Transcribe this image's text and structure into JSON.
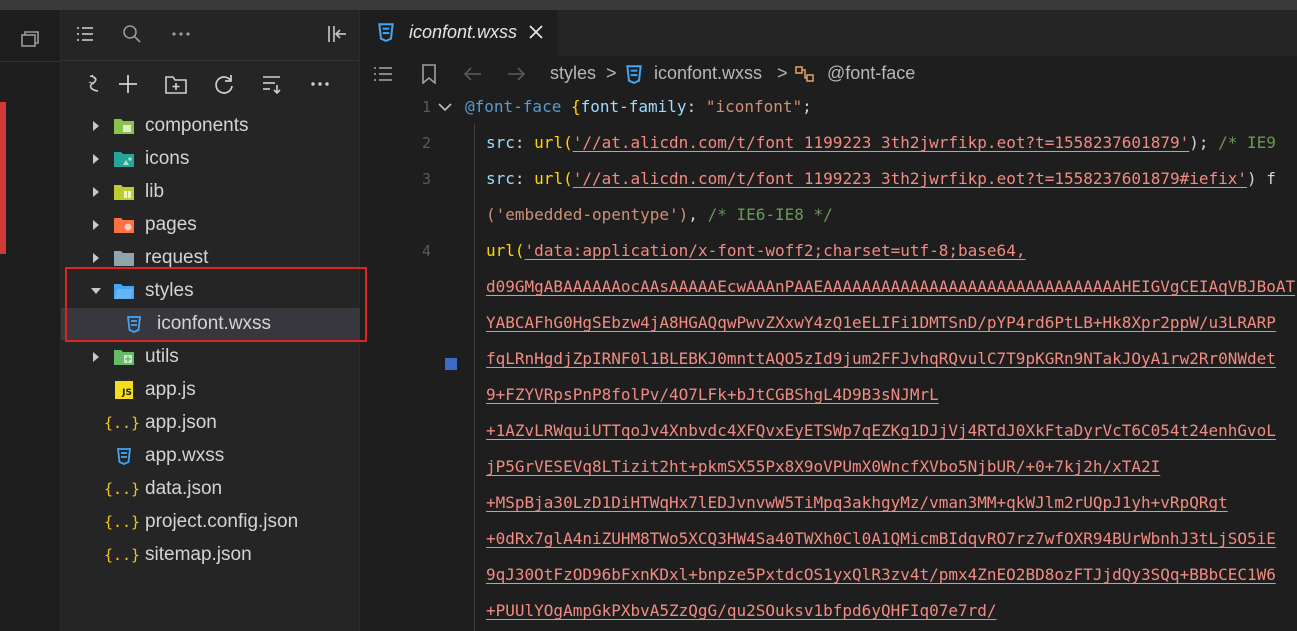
{
  "explorer": {
    "tree": [
      {
        "label": "components",
        "kind": "folder",
        "expanded": false,
        "color": "#8bc34a",
        "icon": "components-folder-icon"
      },
      {
        "label": "icons",
        "kind": "folder",
        "expanded": false,
        "color": "#26a69a",
        "icon": "images-folder-icon"
      },
      {
        "label": "lib",
        "kind": "folder",
        "expanded": false,
        "color": "#c0ca33",
        "icon": "lib-folder-icon"
      },
      {
        "label": "pages",
        "kind": "folder",
        "expanded": false,
        "color": "#ff7043",
        "icon": "pages-folder-icon"
      },
      {
        "label": "request",
        "kind": "folder",
        "expanded": false,
        "color": "#90a4ae",
        "icon": "folder-icon"
      },
      {
        "label": "styles",
        "kind": "folder",
        "expanded": true,
        "color": "#42a5f5",
        "icon": "styles-folder-icon"
      },
      {
        "label": "iconfont.wxss",
        "kind": "file",
        "selected": true,
        "color": "#42a5f5",
        "icon": "css-file-icon"
      },
      {
        "label": "utils",
        "kind": "folder",
        "expanded": false,
        "color": "#66bb6a",
        "icon": "utils-folder-icon"
      },
      {
        "label": "app.js",
        "kind": "file",
        "color": "#f5de19",
        "icon": "js-file-icon"
      },
      {
        "label": "app.json",
        "kind": "file",
        "color": "#f5c518",
        "icon": "json-file-icon"
      },
      {
        "label": "app.wxss",
        "kind": "file",
        "color": "#42a5f5",
        "icon": "css-file-icon"
      },
      {
        "label": "data.json",
        "kind": "file",
        "color": "#f5c518",
        "icon": "json-file-icon"
      },
      {
        "label": "project.config.json",
        "kind": "file",
        "color": "#f5c518",
        "icon": "json-file-icon"
      },
      {
        "label": "sitemap.json",
        "kind": "file",
        "color": "#f5c518",
        "icon": "json-file-icon"
      }
    ],
    "js_badge": "JS",
    "json_badge": "{..}"
  },
  "editor": {
    "tab": {
      "label": "iconfont.wxss",
      "close": "✕"
    },
    "breadcrumb": {
      "folder": "styles",
      "file": "iconfont.wxss",
      "symbol": "@font-face",
      "sep": ">"
    },
    "line_numbers": [
      "1",
      "2",
      "3",
      "4"
    ],
    "code": {
      "l1_kw": "@font-face",
      "l1_brace": " {",
      "l1_prop": "font-family",
      "l1_colon": ": ",
      "l1_val": "\"iconfont\"",
      "l1_semi": ";",
      "src": "src",
      "colon": ": ",
      "url": "url",
      "paren_open": "(",
      "l2_str": "'//at.alicdn.com/t/font_1199223_3th2jwrfikp.eot?t=1558237601879'",
      "l2_tail": "); ",
      "l2_comment": "/* IE9",
      "l3_str": "'//at.alicdn.com/t/font_1199223_3th2jwrfikp.eot?t=1558237601879#iefix'",
      "l3_tail": ") f",
      "l3b_str": "('embedded-opentype')",
      "l3b_tail": ", ",
      "l3b_comment": "/* IE6-IE8 */",
      "l4_str": "'data:application/x-font-woff2;charset=utf-8;base64,",
      "b64": [
        "d09GMgABAAAAAAocAAsAAAAAEcwAAAnPAAEAAAAAAAAAAAAAAAAAAAAAAAAAAAAAAAHEIGVgCEIAqVBJBoAT",
        "YABCAFhG0HgSEbzw4jA8HGAQqwPwvZXxwY4zQ1eELIFi1DMTSnD/pYP4rd6PtLB+Hk8Xpr2ppW/u3LRARP",
        "fqLRnHgdjZpIRNF0l1BLEBKJ0mnttAQO5zId9jum2FFJvhqRQvulC7T9pKGRn9NTakJOyA1rw2Rr0NWdet",
        "9+FZYVRpsPnP8folPv/4O7LFk+bJtCGBShgL4D9B3sNJMrL",
        "+1AZvLRWquiUTTqoJv4Xnbvdc4XFQvxEyETSWp7qEZKg1DJjVj4RTdJ0XkFtaDyrVcT6C054t24enhGvoL",
        "jP5GrVESEVq8LTizit2ht+pkmSX55Px8X9oVPUmX0WncfXVbo5NjbUR/+0+7kj2h/xTA2I",
        "+MSpBja30LzD1DiHTWqHx7lEDJvnvwW5TiMpq3akhgyMz/vman3MM+qkWJlm2rUQpJ1yh+vRpQRgt",
        "+0dRx7glA4niZUHM8TWo5XCQ3HW4Sa40TWXh0Cl0A1QMicmBIdqvRO7rz7wfOXR94BUrWbnhJ3tLjSO5iE",
        "9qJ30OtFzOD96bFxnKDxl+bnpze5PxtdcOS1yxQlR3zv4t/pmx4ZnEO2BD8ozFTJjdQy3SQq+BBbCEC1W6",
        "+PUUlYOgAmpGkPXbvA5ZzQgG/qu2SOuksv1bfpd6yQHFIq07e7rd/"
      ]
    }
  }
}
